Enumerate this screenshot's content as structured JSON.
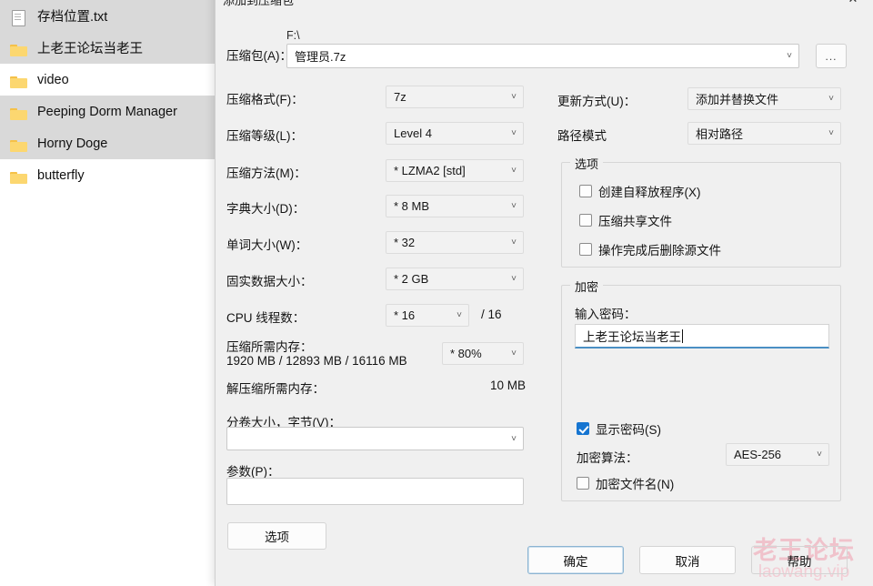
{
  "filelist": [
    {
      "name": "存档位置.txt",
      "icon": "document-icon",
      "selected": true
    },
    {
      "name": "上老王论坛当老王",
      "icon": "folder-icon",
      "selected": true
    },
    {
      "name": "video",
      "icon": "folder-icon",
      "selected": false
    },
    {
      "name": "Peeping Dorm Manager",
      "icon": "folder-icon",
      "selected": true
    },
    {
      "name": "Horny Doge",
      "icon": "folder-icon",
      "selected": true
    },
    {
      "name": "butterfly",
      "icon": "folder-icon",
      "selected": false
    }
  ],
  "dialog": {
    "title": "添加到压缩包",
    "close_icon": "✕",
    "archive": {
      "label": "压缩包(A)：",
      "path": "F:\\",
      "value": "管理员.7z",
      "browse_label": "..."
    },
    "format": {
      "label": "压缩格式(F)：",
      "value": "7z"
    },
    "level": {
      "label": "压缩等级(L)：",
      "value": "Level 4"
    },
    "method": {
      "label": "压缩方法(M)：",
      "value": "* LZMA2 [std]"
    },
    "dict": {
      "label": "字典大小(D)：",
      "value": "* 8 MB"
    },
    "word": {
      "label": "单词大小(W)：",
      "value": "* 32"
    },
    "solid": {
      "label": "固实数据大小：",
      "value": "* 2 GB"
    },
    "threads": {
      "label": "CPU 线程数：",
      "value": "* 16",
      "total": "/ 16"
    },
    "mem_compress": {
      "label": "压缩所需内存：",
      "value": "1920 MB / 12893 MB / 16116 MB",
      "percent": "* 80%"
    },
    "mem_decompress": {
      "label": "解压缩所需内存：",
      "value": "10 MB"
    },
    "volume": {
      "label": "分卷大小，字节(V)：",
      "value": ""
    },
    "params": {
      "label": "参数(P)：",
      "value": ""
    },
    "options_button": "选项",
    "update_mode": {
      "label": "更新方式(U)：",
      "value": "添加并替换文件"
    },
    "path_mode": {
      "label": "路径模式",
      "value": "相对路径"
    },
    "options_group": {
      "title": "选项",
      "items": [
        {
          "label": "创建自释放程序(X)",
          "checked": false
        },
        {
          "label": "压缩共享文件",
          "checked": false
        },
        {
          "label": "操作完成后删除源文件",
          "checked": false
        }
      ]
    },
    "encryption": {
      "title": "加密",
      "password_label": "输入密码：",
      "password_value": "上老王论坛当老王",
      "show_password": {
        "label": "显示密码(S)",
        "checked": true
      },
      "algorithm_label": "加密算法：",
      "algorithm_value": "AES-256",
      "encrypt_names": {
        "label": "加密文件名(N)",
        "checked": false
      }
    },
    "buttons": {
      "ok": "确定",
      "cancel": "取消",
      "help": "帮助"
    }
  },
  "watermark": {
    "line1": "老王论坛",
    "line2": "laowang.vip"
  }
}
